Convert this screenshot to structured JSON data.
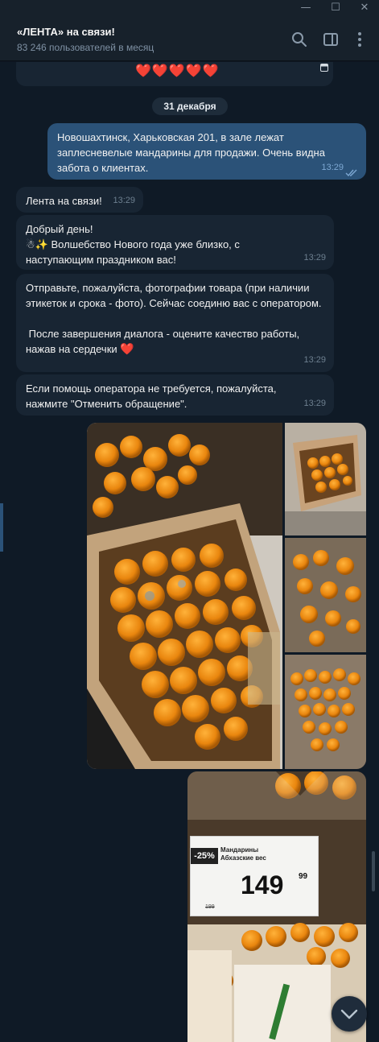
{
  "window": {
    "minimize": "—",
    "maximize": "☐",
    "close": "✕"
  },
  "header": {
    "title": "«ЛЕНТА» на связи!",
    "subtitle": "83 246 пользователей в месяц"
  },
  "top_bubble": {
    "hearts": "❤️❤️❤️❤️❤️"
  },
  "date_separator": "31 декабря",
  "messages": [
    {
      "direction": "out",
      "text": "Новошахтинск, Харьковская 201, в зале лежат заплесневелые мандарины для продажи. Очень видна забота о клиентах.",
      "time": "13:29"
    },
    {
      "direction": "in",
      "text": "Лента на связи!",
      "time": "13:29"
    },
    {
      "direction": "in",
      "line1": "Добрый день!",
      "line2": "☃✨ Волшебство Нового года уже близко, с наступающим праздником вас!",
      "time": "13:29"
    },
    {
      "direction": "in",
      "para1": "Отправьте, пожалуйста, фотографии товара (при наличии этикеток и срока - фото). Сейчас соединю вас с оператором.",
      "para2": " После завершения диалога - оцените качество работы, нажав на сердечки",
      "heart": "❤️",
      "time": "13:29"
    },
    {
      "direction": "in",
      "text": "Если помощь оператора не требуется, пожалуйста, нажмите \"Отменить обращение\".",
      "time": "13:29"
    }
  ],
  "price_tag": {
    "discount": "-25%",
    "name_line1": "Мандарины",
    "name_line2": "Абхазские вес",
    "price_rub": "149",
    "price_kop": "99",
    "old_price": "199"
  },
  "colors": {
    "background": "#0f1a26",
    "bubble_in": "#182533",
    "bubble_out": "#2b5278",
    "header": "#17212b"
  }
}
